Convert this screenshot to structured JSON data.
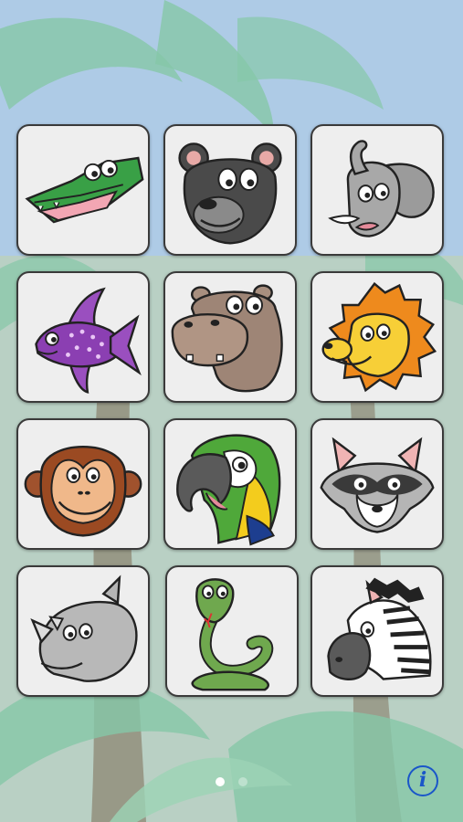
{
  "theme": {
    "sky": "#a9c6e6",
    "foliage": "#86c7a8",
    "trunk": "#7a6a55",
    "tile_bg": "#eeeeee",
    "tile_border": "#3a3a3a",
    "info_color": "#1a56c9"
  },
  "tiles": [
    {
      "animal": "crocodile",
      "icon": "crocodile-icon"
    },
    {
      "animal": "bear",
      "icon": "bear-icon"
    },
    {
      "animal": "elephant",
      "icon": "elephant-icon"
    },
    {
      "animal": "fish",
      "icon": "fish-icon"
    },
    {
      "animal": "hippo",
      "icon": "hippo-icon"
    },
    {
      "animal": "lion",
      "icon": "lion-icon"
    },
    {
      "animal": "monkey",
      "icon": "monkey-icon"
    },
    {
      "animal": "parrot",
      "icon": "parrot-icon"
    },
    {
      "animal": "raccoon",
      "icon": "raccoon-icon"
    },
    {
      "animal": "rhino",
      "icon": "rhino-icon"
    },
    {
      "animal": "snake",
      "icon": "snake-icon"
    },
    {
      "animal": "zebra",
      "icon": "zebra-icon"
    }
  ],
  "pager": {
    "pages": 2,
    "current": 1
  },
  "info_button": {
    "label": "i",
    "icon": "info-icon"
  }
}
